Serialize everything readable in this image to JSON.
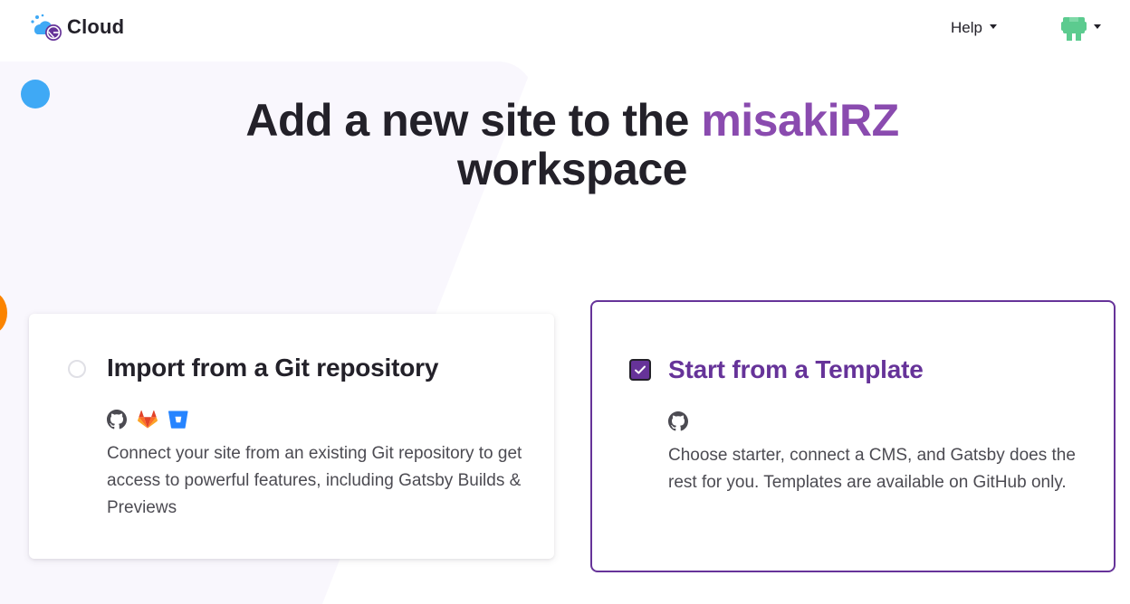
{
  "header": {
    "brand_name": "Cloud",
    "help_label": "Help"
  },
  "page": {
    "title_prefix": "Add a new site to the",
    "workspace_name": "misakiRZ",
    "title_suffix": "workspace"
  },
  "options": {
    "import": {
      "title": "Import from a Git repository",
      "description": "Connect your site from an existing Git repository to get access to powerful features, including Gatsby Builds & Previews",
      "providers": [
        "github-icon",
        "gitlab-icon",
        "bitbucket-icon"
      ],
      "selected": false
    },
    "template": {
      "title": "Start from a Template",
      "description": "Choose starter, connect a CMS, and Gatsby does the rest for you. Templates are available on GitHub only.",
      "providers": [
        "github-icon"
      ],
      "selected": true
    }
  },
  "colors": {
    "accent": "#663399",
    "accent_light": "#8a4baf",
    "text": "#232129",
    "muted_text": "#4c4b52",
    "gitlab": "#fc6d26",
    "bitbucket": "#2684ff",
    "avatar": "#5ccb8f",
    "blue_dot": "#3fa9f5",
    "orange_dot": "#fb8400"
  }
}
